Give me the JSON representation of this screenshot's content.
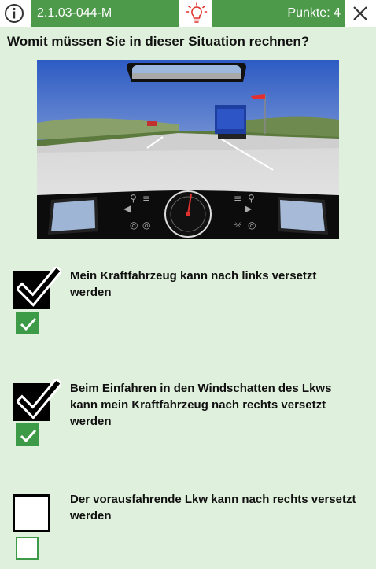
{
  "header": {
    "question_id": "2.1.03-044-M",
    "points": "Punkte: 4"
  },
  "question": "Womit müssen Sie in dieser Situation rechnen?",
  "answers": [
    {
      "text": "Mein Kraftfahrzeug kann nach links versetzt werden",
      "checked": true,
      "correct": true
    },
    {
      "text": "Beim Einfahren in den Windschatten des Lkws kann mein Kraftfahrzeug nach rechts versetzt werden",
      "checked": true,
      "correct": true
    },
    {
      "text": "Der vorausfahrende Lkw kann nach rechts versetzt werden",
      "checked": false,
      "correct": false
    }
  ],
  "scene": {
    "speedometer_unit": "km/h",
    "speedometer_ticks": [
      "0",
      "20",
      "40",
      "60",
      "80",
      "100",
      "120",
      "140",
      "160"
    ]
  },
  "colors": {
    "background": "#dff1dc",
    "header_green": "#4e9a4b",
    "check_green": "#3d9a47",
    "bulb_red": "#e0312b"
  },
  "icons": {
    "info": "info-icon",
    "hint": "lightbulb-icon",
    "close": "close-icon",
    "check": "checkmark-icon"
  }
}
